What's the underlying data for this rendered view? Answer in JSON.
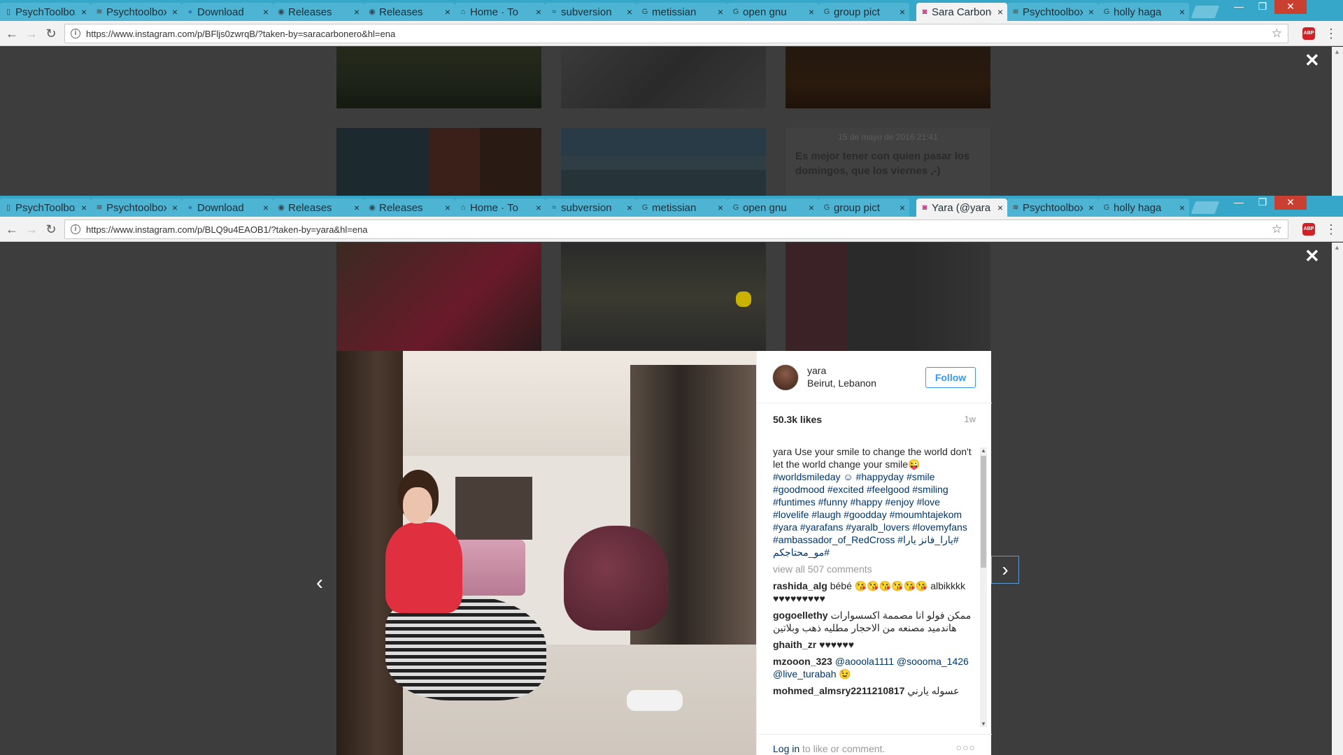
{
  "tabs": [
    {
      "label": "PsychToolbox",
      "icon": "page-icon"
    },
    {
      "label": "Psychtoolbox",
      "icon": "wave-icon"
    },
    {
      "label": "Download",
      "icon": "dot-icon"
    },
    {
      "label": "Releases",
      "icon": "github-icon"
    },
    {
      "label": "Releases",
      "icon": "github-icon"
    },
    {
      "label": "Home · To",
      "icon": "home-icon"
    },
    {
      "label": "subversion",
      "icon": "svn-icon"
    },
    {
      "label": "metissian",
      "icon": "google-icon"
    },
    {
      "label": "open gnu",
      "icon": "google-icon"
    },
    {
      "label": "group pict",
      "icon": "google-icon"
    }
  ],
  "tabs_after": [
    {
      "label": "Psychtoolbox",
      "icon": "wave-icon"
    },
    {
      "label": "holly haga",
      "icon": "google-icon"
    }
  ],
  "tab_close": "×",
  "window1": {
    "active_tab": "Sara Carbonero",
    "url": "https://www.instagram.com/p/BFljs0zwrqB/?taken-by=saracarbonero&hl=ena",
    "date": "15 de mayo de 2016 21:41",
    "quote": "Es mejor tener con quien pasar los domingos, que los viernes ,-)"
  },
  "window2": {
    "active_tab": "Yara (@yara",
    "url": "https://www.instagram.com/p/BLQ9u4EAOB1/?taken-by=yara&hl=ena"
  },
  "icons": {
    "back": "←",
    "forward": "→",
    "reload": "↻",
    "star": "☆",
    "abp": "ABP",
    "menu": "⋮",
    "close_modal": "✕",
    "prev": "‹",
    "next": "›",
    "minimize": "—",
    "maximize": "❐",
    "close": "✕"
  },
  "post": {
    "username": "yara",
    "location": "Beirut, Lebanon",
    "follow_label": "Follow",
    "likes": "50.3k likes",
    "ago": "1w",
    "caption_user": "yara",
    "caption_text": "Use your smile to change the world don't let the world change your smile😜",
    "hashtags": "#worldsmileday ☺ #happyday #smile #goodmood #excited #feelgood #smiling #funtimes #funny #happy #enjoy #love #lovelife #laugh #goodday #moumhtajekom #yara #yarafans #yaralb_lovers #lovemyfans #ambassador_of_RedCross",
    "arabic_tags": "#يارا_فانز #مو_محتاجكم",
    "arabic_tags2": "#يارا",
    "view_all": "view all 507 comments",
    "comments": [
      {
        "user": "rashida_alg",
        "text": "bébé 😘😘😘😘😘😘 albikkkk ♥♥♥♥♥♥♥♥♥"
      },
      {
        "user": "gogoellethy",
        "text": "ممكن فولو انا مصممة اكسسوارات هاندميد مصنعه من الاحجار مطليه ذهب وبلاتين"
      },
      {
        "user": "ghaith_zr",
        "text": "♥♥♥♥♥♥"
      },
      {
        "user": "mzooon_323",
        "text": "@aooola1111 @soooma_1426 @live_turabah 😉"
      },
      {
        "user": "mohmed_almsry2211210817",
        "text": "عسوله يارني"
      }
    ],
    "login_link": "Log in",
    "login_rest": " to like or comment.",
    "more": "○○○"
  }
}
